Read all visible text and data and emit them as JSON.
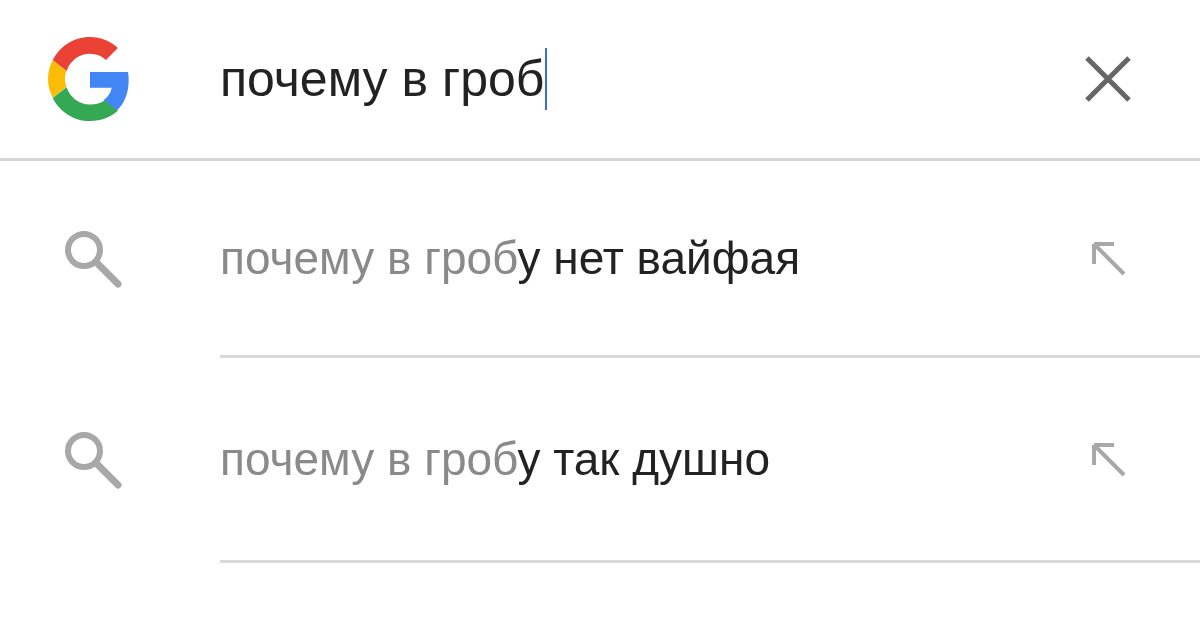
{
  "search": {
    "value": "почему в гроб",
    "focused": true
  },
  "suggestions": [
    {
      "matched": "почему в гроб",
      "completion": "у нет вайфая"
    },
    {
      "matched": "почему в гроб",
      "completion": "у так душно"
    }
  ]
}
